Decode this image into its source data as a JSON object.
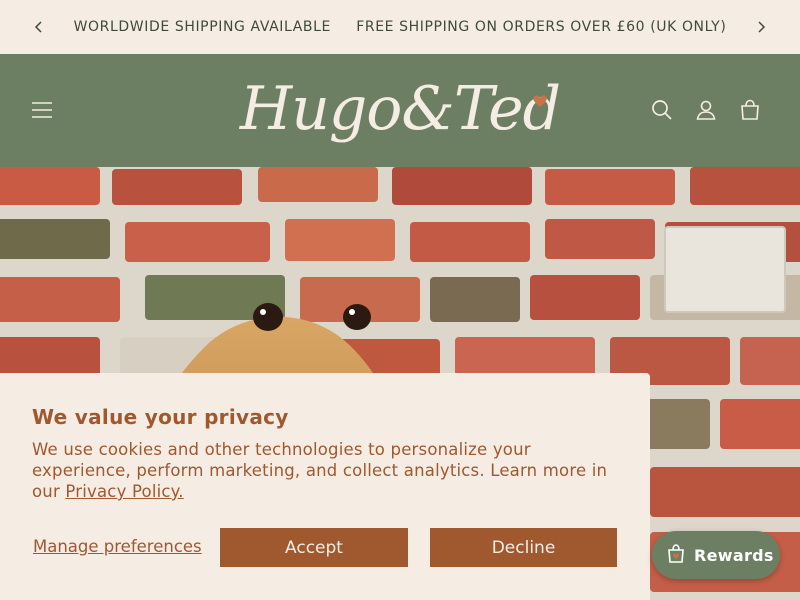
{
  "announcement": {
    "messages": "WORLDWIDE SHIPPING AVAILABLE     FREE SHIPPING ON ORDERS OVER £60 (UK ONLY)",
    "prev_icon": "chevron-left-icon",
    "next_icon": "chevron-right-icon"
  },
  "header": {
    "logo_text": "Hugo&Ted",
    "menu_icon": "menu-icon",
    "search_icon": "search-icon",
    "account_icon": "account-icon",
    "cart_icon": "cart-icon"
  },
  "cookie_banner": {
    "title": "We value your privacy",
    "body": "We use cookies and other technologies to personalize your experience, perform marketing, and collect analytics. Learn more in our ",
    "link_label": "Privacy Policy.",
    "manage_label": "Manage preferences",
    "accept_label": "Accept",
    "decline_label": "Decline"
  },
  "rewards": {
    "label": "Rewards",
    "icon": "gift-bag-icon"
  },
  "colors": {
    "header_green": "#6d7f63",
    "cream": "#f5ece4",
    "rust": "#a0582f",
    "heart": "#c8734a"
  }
}
